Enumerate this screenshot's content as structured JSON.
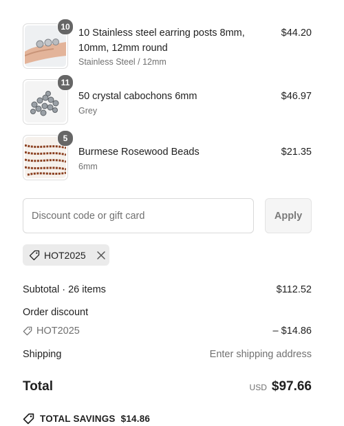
{
  "items": [
    {
      "name": "10 Stainless steel earring posts 8mm, 10mm, 12mm round",
      "variant": "Stainless Steel / 12mm",
      "price": "$44.20",
      "quantity": "10",
      "image_icon": "earring-posts-image"
    },
    {
      "name": "50 crystal cabochons 6mm",
      "variant": "Grey",
      "price": "$46.97",
      "quantity": "11",
      "image_icon": "crystal-cabochons-image"
    },
    {
      "name": "Burmese Rosewood Beads",
      "variant": "6mm",
      "price": "$21.35",
      "quantity": "5",
      "image_icon": "rosewood-beads-image"
    }
  ],
  "discount": {
    "placeholder": "Discount code or gift card",
    "apply_label": "Apply",
    "applied_code": "HOT2025"
  },
  "summary": {
    "subtotal_label": "Subtotal · 26 items",
    "subtotal_value": "$112.52",
    "order_discount_label": "Order discount",
    "discount_code": "HOT2025",
    "discount_value": "– $14.86",
    "shipping_label": "Shipping",
    "shipping_value": "Enter shipping address",
    "total_label": "Total",
    "currency": "USD",
    "total_value": "$97.66",
    "savings_label": "TOTAL SAVINGS",
    "savings_value": "$14.86"
  },
  "colors": {
    "badge": "#666666",
    "chip": "#ebebeb",
    "muted": "#707070"
  }
}
